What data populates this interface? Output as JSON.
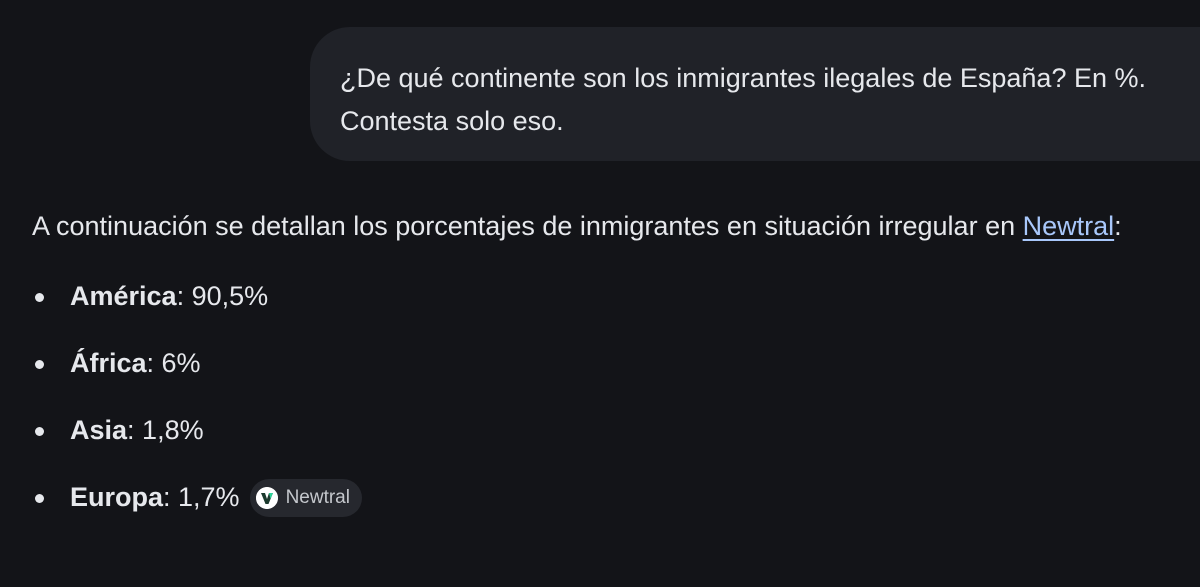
{
  "user_message": {
    "text": "¿De qué continente son los inmigrantes ilegales de España? En %. Contesta solo eso."
  },
  "response": {
    "intro_before_link": "A continuación se detallan los porcentajes de inmigrantes en situación irregular en ",
    "link_text": "Newtral",
    "intro_after_link": ":",
    "items": [
      {
        "name": "América",
        "value": ": 90,5%"
      },
      {
        "name": "África",
        "value": ": 6%"
      },
      {
        "name": "Asia",
        "value": ": 1,8%"
      },
      {
        "name": "Europa",
        "value": ": 1,7%"
      }
    ],
    "source_chip": {
      "label": "Newtral",
      "icon": "newtral-logo-icon"
    }
  },
  "colors": {
    "background": "#131418",
    "bubble": "#202228",
    "link": "#a8c7fa",
    "text": "#e6e8ec"
  }
}
